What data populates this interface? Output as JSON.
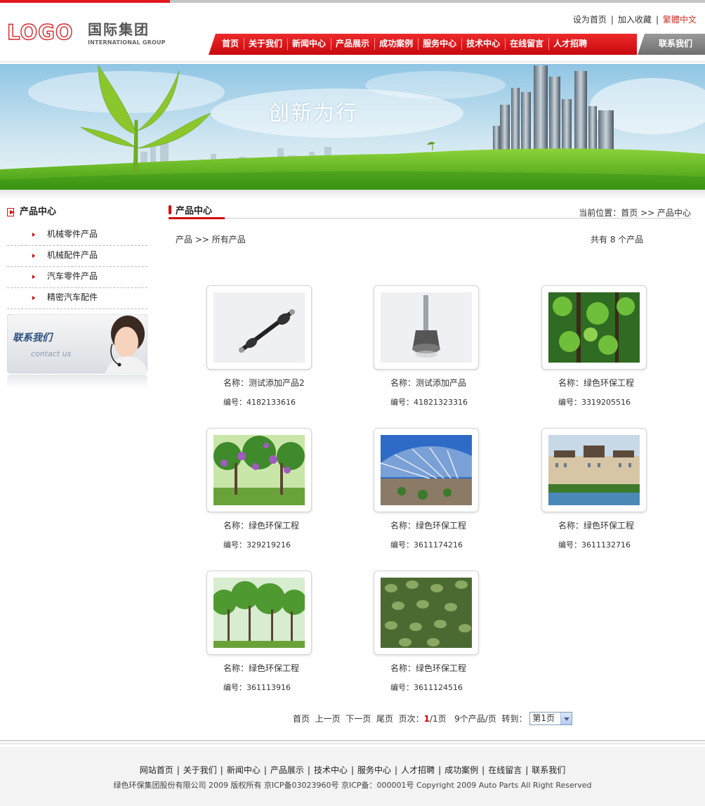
{
  "header": {
    "logo_text": "LOGO",
    "group_cn": "国际集团",
    "group_en": "INTERNATIONAL GROUP",
    "toplinks": [
      "设为首页",
      "加入收藏",
      "繁體中文"
    ],
    "nav": [
      "首页",
      "关于我们",
      "新闻中心",
      "产品展示",
      "成功案例",
      "服务中心",
      "技术中心",
      "在线留言",
      "人才招聘"
    ],
    "nav_contact": "联系我们"
  },
  "banner": {
    "title": "创新为行"
  },
  "sidebar": {
    "title": "产品中心",
    "items": [
      "机械零件产品",
      "机械配件产品",
      "汽车零件产品",
      "精密汽车配件"
    ],
    "contact_cn": "联系我们",
    "contact_en": "contact us"
  },
  "main": {
    "title": "产品中心",
    "location": "当前位置：首页 >> 产品中心",
    "breadcrumb": "产品 >> 所有产品",
    "count": "共有 8 个产品",
    "products": [
      {
        "name": "名称：测试添加产品2",
        "code": "编号：4182133616",
        "pic": "axle"
      },
      {
        "name": "名称：测试添加产品",
        "code": "编号：41821323316",
        "pic": "joint"
      },
      {
        "name": "名称：绿色环保工程",
        "code": "编号：3319205516",
        "pic": "tree-leaves"
      },
      {
        "name": "名称：绿色环保工程",
        "code": "编号：329219216",
        "pic": "purple-trees"
      },
      {
        "name": "名称：绿色环保工程",
        "code": "编号：3611174216",
        "pic": "stadium"
      },
      {
        "name": "名称：绿色环保工程",
        "code": "编号：3611132716",
        "pic": "hotel"
      },
      {
        "name": "名称：绿色环保工程",
        "code": "编号：361113916",
        "pic": "green-trees"
      },
      {
        "name": "名称：绿色环保工程",
        "code": "编号：3611124516",
        "pic": "ivy-wall"
      }
    ]
  },
  "pager": {
    "first": "首页",
    "prev": "上一页",
    "next": "下一页",
    "last": "尾页",
    "page_label": "页次：",
    "page_current": "1",
    "page_total": "/1页",
    "per_page": "9个产品/页",
    "goto": "转到：",
    "select_value": "第1页"
  },
  "footer": {
    "nav": [
      "网站首页",
      "关于我们",
      "新闻中心",
      "产品展示",
      "技术中心",
      "服务中心",
      "人才招聘",
      "成功案例",
      "在线留言",
      "联系我们"
    ],
    "copyright": "绿色环保集团股份有限公司 2009 版权所有 京ICP备03023960号 京ICP备：000001号 Copyright 2009 Auto Parts All Right Reserved"
  },
  "colors": {
    "brand_red": "#e3171e",
    "nav_red": "#d3101a",
    "nav_gray": "#8a8a8a"
  }
}
